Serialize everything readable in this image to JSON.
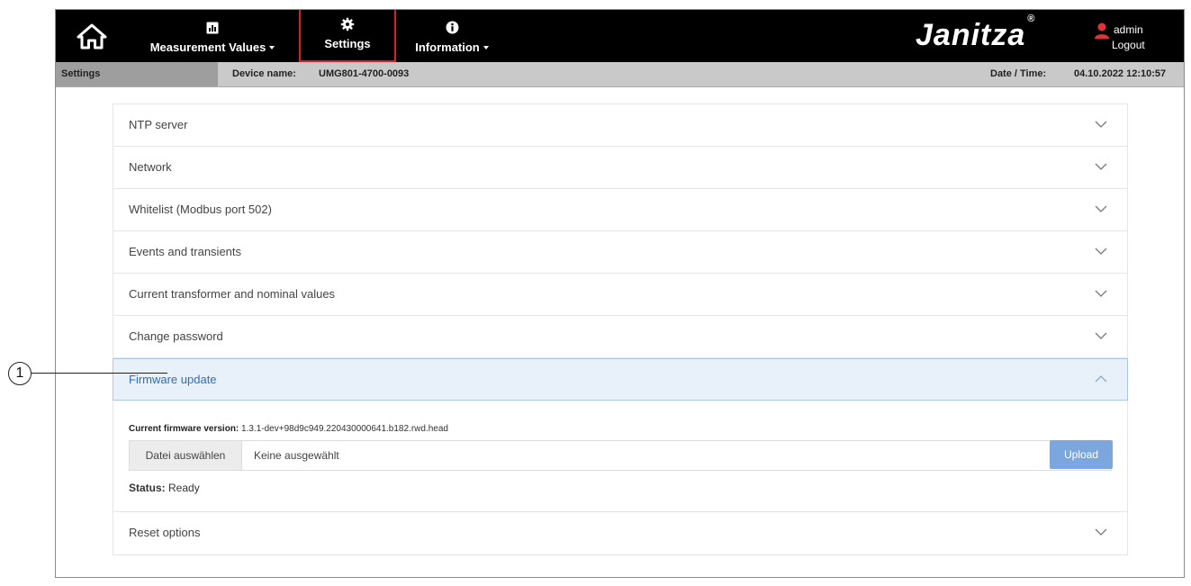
{
  "nav": {
    "home_icon": "home-icon",
    "items": [
      {
        "label": "Measurement Values",
        "icon": "chart-icon",
        "has_dropdown": true
      },
      {
        "label": "Settings",
        "icon": "gear-icon",
        "has_dropdown": false,
        "highlighted": true
      },
      {
        "label": "Information",
        "icon": "info-icon",
        "has_dropdown": true
      }
    ],
    "logo": "Janitza",
    "logo_mark": "®",
    "user": "admin",
    "logout": "Logout"
  },
  "infobar": {
    "section": "Settings",
    "device_label": "Device name:",
    "device_value": "UMG801-4700-0093",
    "datetime_label": "Date / Time:",
    "datetime_value": "04.10.2022 12:10:57"
  },
  "accordion": {
    "items": [
      {
        "title": "NTP server",
        "expanded": false
      },
      {
        "title": "Network",
        "expanded": false
      },
      {
        "title": "Whitelist (Modbus port 502)",
        "expanded": false
      },
      {
        "title": "Events and transients",
        "expanded": false
      },
      {
        "title": "Current transformer and nominal values",
        "expanded": false
      },
      {
        "title": "Change password",
        "expanded": false
      },
      {
        "title": "Firmware update",
        "expanded": true
      },
      {
        "title": "Reset options",
        "expanded": false
      }
    ]
  },
  "firmware": {
    "version_label": "Current firmware version:",
    "version_value": "1.3.1-dev+98d9c949.220430000641.b182.rwd.head",
    "choose_file": "Datei auswählen",
    "file_placeholder": "Keine ausgewählt",
    "upload": "Upload",
    "status_label": "Status:",
    "status_value": "Ready"
  },
  "callout": {
    "number": "1"
  },
  "colors": {
    "topbar": "#000000",
    "highlight_border": "#d3222f",
    "active_row_bg": "#e8f1fa",
    "active_text": "#2f6db5",
    "upload_btn": "#7ba7de",
    "user_icon": "#e0323c"
  }
}
